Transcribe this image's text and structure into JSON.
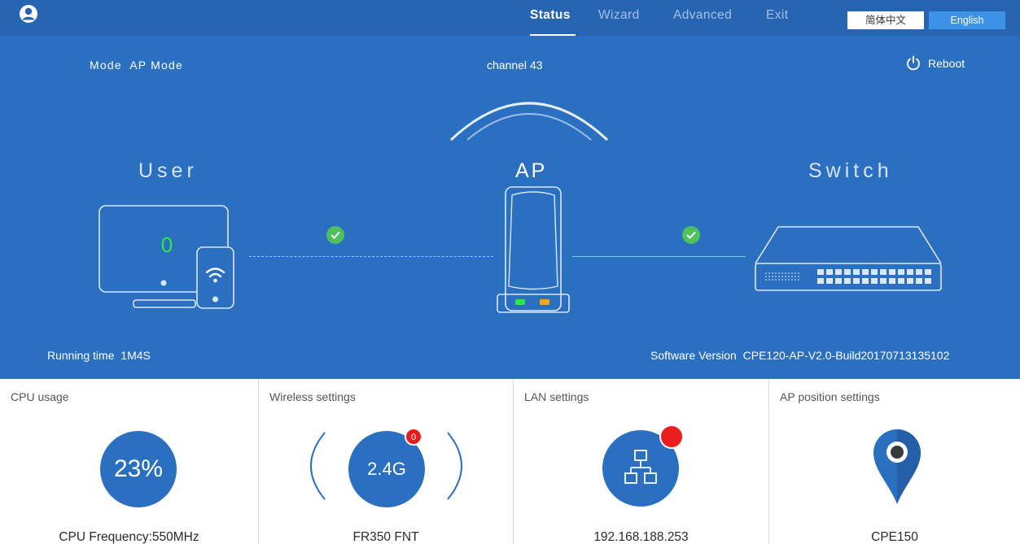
{
  "header": {
    "nav": [
      {
        "label": "Status",
        "active": true
      },
      {
        "label": "Wizard",
        "active": false
      },
      {
        "label": "Advanced",
        "active": false
      },
      {
        "label": "Exit",
        "active": false
      }
    ],
    "lang_cn": "简体中文",
    "lang_en": "English",
    "selected_language": "English"
  },
  "status": {
    "mode_label": "Mode",
    "mode_value": "AP Mode",
    "channel_label": "channel",
    "channel_value": "43",
    "reboot_label": "Reboot",
    "user_label": "User",
    "ap_label": "AP",
    "switch_label": "Switch",
    "user_count": "0",
    "running_label": "Running time",
    "running_value": "1M4S",
    "software_label": "Software Version",
    "software_value": "CPE120-AP-V2.0-Build20170713135102",
    "user_link_ok": true,
    "switch_link_ok": true
  },
  "panels": {
    "cpu": {
      "title": "CPU usage",
      "value": "23%",
      "footer": "CPU Frequency:550MHz"
    },
    "wireless": {
      "title": "Wireless settings",
      "band": "2.4G",
      "badge": "0",
      "footer": "FR350 FNT"
    },
    "lan": {
      "title": "LAN settings",
      "footer": "192.168.188.253"
    },
    "position": {
      "title": "AP position settings",
      "footer": "CPE150"
    }
  },
  "colors": {
    "hero_blue": "#2b6fc0",
    "topbar_blue": "#2765b3",
    "accent_blue": "#3d92e8",
    "status_green": "#4ec15c",
    "alert_red": "#e51c1c"
  },
  "icons": [
    "user-avatar-icon",
    "power-icon",
    "signal-arcs-icon",
    "pc-icon",
    "phone-wifi-icon",
    "access-point-icon",
    "network-switch-icon",
    "check-icon",
    "network-topology-icon",
    "location-pin-icon"
  ]
}
